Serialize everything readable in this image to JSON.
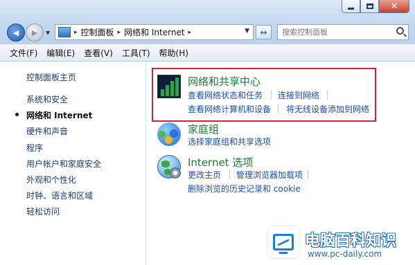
{
  "window": {
    "controls": {
      "minimize_icon": "minimize-icon",
      "maximize_icon": "maximize-icon",
      "close_symbol": "✕"
    }
  },
  "address_bar": {
    "back_symbol": "◀",
    "forward_symbol": "▶",
    "crumbs": [
      "控制面板",
      "网络和 Internet"
    ],
    "separator": "▸",
    "dropdown_symbol": "▼",
    "refresh_symbol": "↔"
  },
  "search": {
    "placeholder": "搜索控制面板"
  },
  "menu": {
    "items": [
      "文件(F)",
      "编辑(E)",
      "查看(V)",
      "工具(T)",
      "帮助(H)"
    ]
  },
  "sidebar": {
    "home": "控制面板主页",
    "items": [
      {
        "label": "系统和安全",
        "active": false
      },
      {
        "label": "网络和 Internet",
        "active": true
      },
      {
        "label": "硬件和声音",
        "active": false
      },
      {
        "label": "程序",
        "active": false
      },
      {
        "label": "用户帐户和家庭安全",
        "active": false
      },
      {
        "label": "外观和个性化",
        "active": false
      },
      {
        "label": "时钟、语言和区域",
        "active": false
      },
      {
        "label": "轻松访问",
        "active": false
      }
    ]
  },
  "categories": [
    {
      "title": "网络和共享中心",
      "icon": "network-icon",
      "links": [
        "查看网络状态和任务",
        "连接到网络",
        "查看网络计算机和设备",
        "将无线设备添加到网络"
      ],
      "highlighted": true
    },
    {
      "title": "家庭组",
      "icon": "homegroup-icon",
      "links": [
        "选择家庭组和共享选项"
      ]
    },
    {
      "title": "Internet 选项",
      "icon": "internet-options-icon",
      "links": [
        "更改主页",
        "管理浏览器加载项",
        "删除浏览的历史记录和 cookie"
      ]
    }
  ],
  "watermark": {
    "title": "电脑百科知识",
    "url": "www.pc-daily.com"
  },
  "colors": {
    "link": "#1b4fb0",
    "category_title": "#1e7a35",
    "highlight_box": "#d1242b",
    "sidebar_text": "#1e3b6e"
  }
}
